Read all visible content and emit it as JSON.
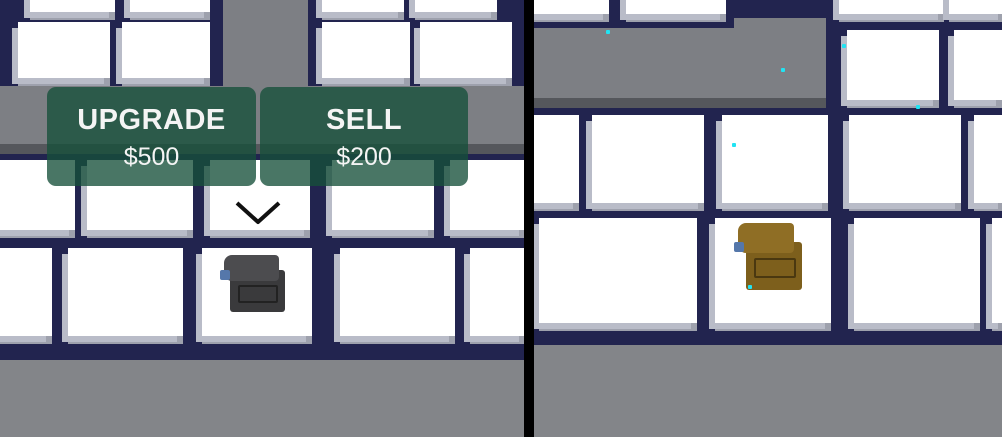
{
  "tower_menu": {
    "upgrade": {
      "label": "UPGRADE",
      "price": "$500"
    },
    "sell": {
      "label": "SELL",
      "price": "$200"
    }
  },
  "colors": {
    "grid_line": "#22244f",
    "tile": "#ffffff",
    "road": "#7d7f84",
    "menu_button": "#16503a",
    "turret_basic": "#3d3d3f",
    "turret_upgraded": "#8a6a1f",
    "spark": "#21e3f3"
  },
  "icons": [
    "chevron-down-icon",
    "turret-icon"
  ]
}
